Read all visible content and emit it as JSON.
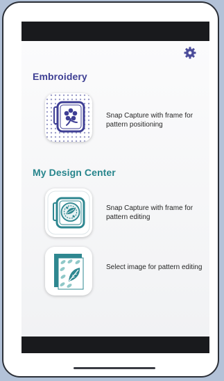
{
  "icons": {
    "settings": "gear-icon",
    "embroidery_option": "embroidery-frame-flower-icon",
    "design_capture_option": "design-frame-icon",
    "image_option": "leaf-image-icon"
  },
  "colors": {
    "embroidery_heading": "#3e3f93",
    "design_heading": "#26858c",
    "teal": "#2e8790",
    "navy": "#3f3f95"
  },
  "sections": {
    "embroidery": {
      "title": "Embroidery",
      "options": [
        {
          "label": "Snap Capture with frame for pattern positioning",
          "icon": "embroidery-frame-flower-icon"
        }
      ]
    },
    "design_center": {
      "title": "My Design Center",
      "options": [
        {
          "label": "Snap Capture with frame for pattern editing",
          "icon": "design-frame-icon"
        },
        {
          "label": "Select image for pattern editing",
          "icon": "leaf-image-icon"
        }
      ]
    }
  }
}
